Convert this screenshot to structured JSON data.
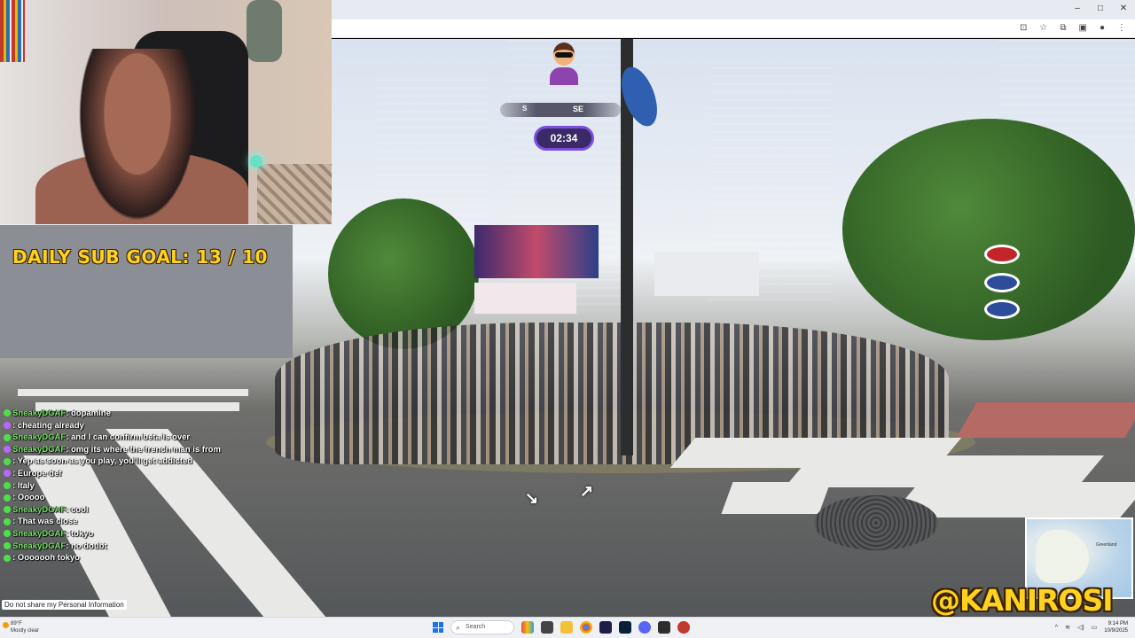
{
  "overlay": {
    "sub_goal": "DAILY SUB GOAL: 13 / 10",
    "handle": "@KANIROSI"
  },
  "game": {
    "compass": [
      "S",
      "SE"
    ],
    "timer": "02:34",
    "minimap_label": "Greenland"
  },
  "chat": [
    {
      "user": "SneakyDGAF",
      "text": "dopamine",
      "badge": "green"
    },
    {
      "user": "",
      "text": "cheating already",
      "badge": "purple"
    },
    {
      "user": "SneakyDGAF",
      "text": "and I can confirm beta is over",
      "badge": "green"
    },
    {
      "user": "SneakyDGAF",
      "text": "omg its where the french man is from",
      "badge": "purple"
    },
    {
      "user": "",
      "text": "Yep as soon as you play, you'll get addicted",
      "badge": "green"
    },
    {
      "user": "",
      "text": "Europe def",
      "badge": "purple"
    },
    {
      "user": "",
      "text": "Italy",
      "badge": "green"
    },
    {
      "user": "",
      "text": "Ooooo",
      "badge": "green"
    },
    {
      "user": "SneakyDGAF",
      "text": "cool",
      "badge": "green"
    },
    {
      "user": "",
      "text": "That was close",
      "badge": "green"
    },
    {
      "user": "SneakyDGAF",
      "text": "tokyo",
      "badge": "green"
    },
    {
      "user": "SneakyDGAF",
      "text": "no doubt",
      "badge": "green"
    },
    {
      "user": "",
      "text": "Ooooooh tokyo",
      "badge": "green"
    }
  ],
  "privacy_link": "Do not share my Personal Information",
  "taskbar": {
    "weather_temp": "89°F",
    "weather_desc": "Mostly clear",
    "search_placeholder": "Search",
    "time": "9:14 PM",
    "date": "10/9/2025"
  },
  "window_controls": [
    "–",
    "□",
    "✕"
  ],
  "colors": {
    "accent_yellow": "#ffd21f",
    "timer_border": "#7a4fe0",
    "chat_user": "#7be36b"
  }
}
